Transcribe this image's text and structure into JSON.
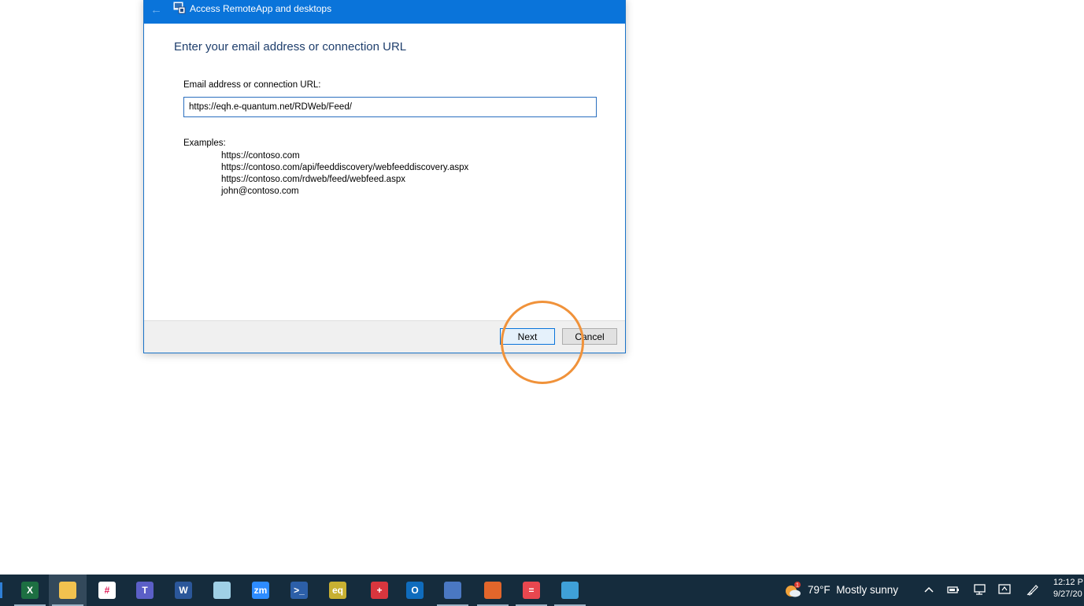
{
  "dialog": {
    "title": "Access RemoteApp and desktops",
    "heading": "Enter your email address or connection URL",
    "field_label": "Email address or connection URL:",
    "url_value": "https://eqh.e-quantum.net/RDWeb/Feed/",
    "examples_label": "Examples:",
    "examples": [
      "https://contoso.com",
      "https://contoso.com/api/feeddiscovery/webfeeddiscovery.aspx",
      "https://contoso.com/rdweb/feed/webfeed.aspx",
      "john@contoso.com"
    ],
    "next_label": "Next",
    "cancel_label": "Cancel"
  },
  "taskbar": {
    "apps": [
      {
        "name": "excel-icon",
        "color": "#1d6f42",
        "glyph": "X"
      },
      {
        "name": "file-explorer-icon",
        "color": "#f2c24f",
        "glyph": ""
      },
      {
        "name": "slack-icon",
        "color": "#ffffff",
        "glyph": "#"
      },
      {
        "name": "teams-icon",
        "color": "#5b5fc7",
        "glyph": "T"
      },
      {
        "name": "word-icon",
        "color": "#2b579a",
        "glyph": "W"
      },
      {
        "name": "notes-icon",
        "color": "#9fd0e6",
        "glyph": ""
      },
      {
        "name": "zoom-icon",
        "color": "#2d8cff",
        "glyph": "zm"
      },
      {
        "name": "powershell-icon",
        "color": "#2c5fa8",
        "glyph": ">_"
      },
      {
        "name": "eq-app-icon",
        "color": "#c8b032",
        "glyph": "eq"
      },
      {
        "name": "remote-tools-icon",
        "color": "#d9363e",
        "glyph": "+"
      },
      {
        "name": "outlook-icon",
        "color": "#0f6cbd",
        "glyph": "O"
      },
      {
        "name": "remote-desktop-connection-icon",
        "color": "#4a78c2",
        "glyph": ""
      },
      {
        "name": "support-agent-icon",
        "color": "#e2662b",
        "glyph": ""
      },
      {
        "name": "red-app-icon",
        "color": "#e8474f",
        "glyph": "="
      },
      {
        "name": "remoteapp-icon",
        "color": "#3fa0d8",
        "glyph": ""
      }
    ],
    "weather": {
      "temp": "79°F",
      "condition": "Mostly sunny",
      "alert_count": "1"
    },
    "clock": {
      "time": "12:12 P",
      "date": "9/27/20"
    }
  }
}
